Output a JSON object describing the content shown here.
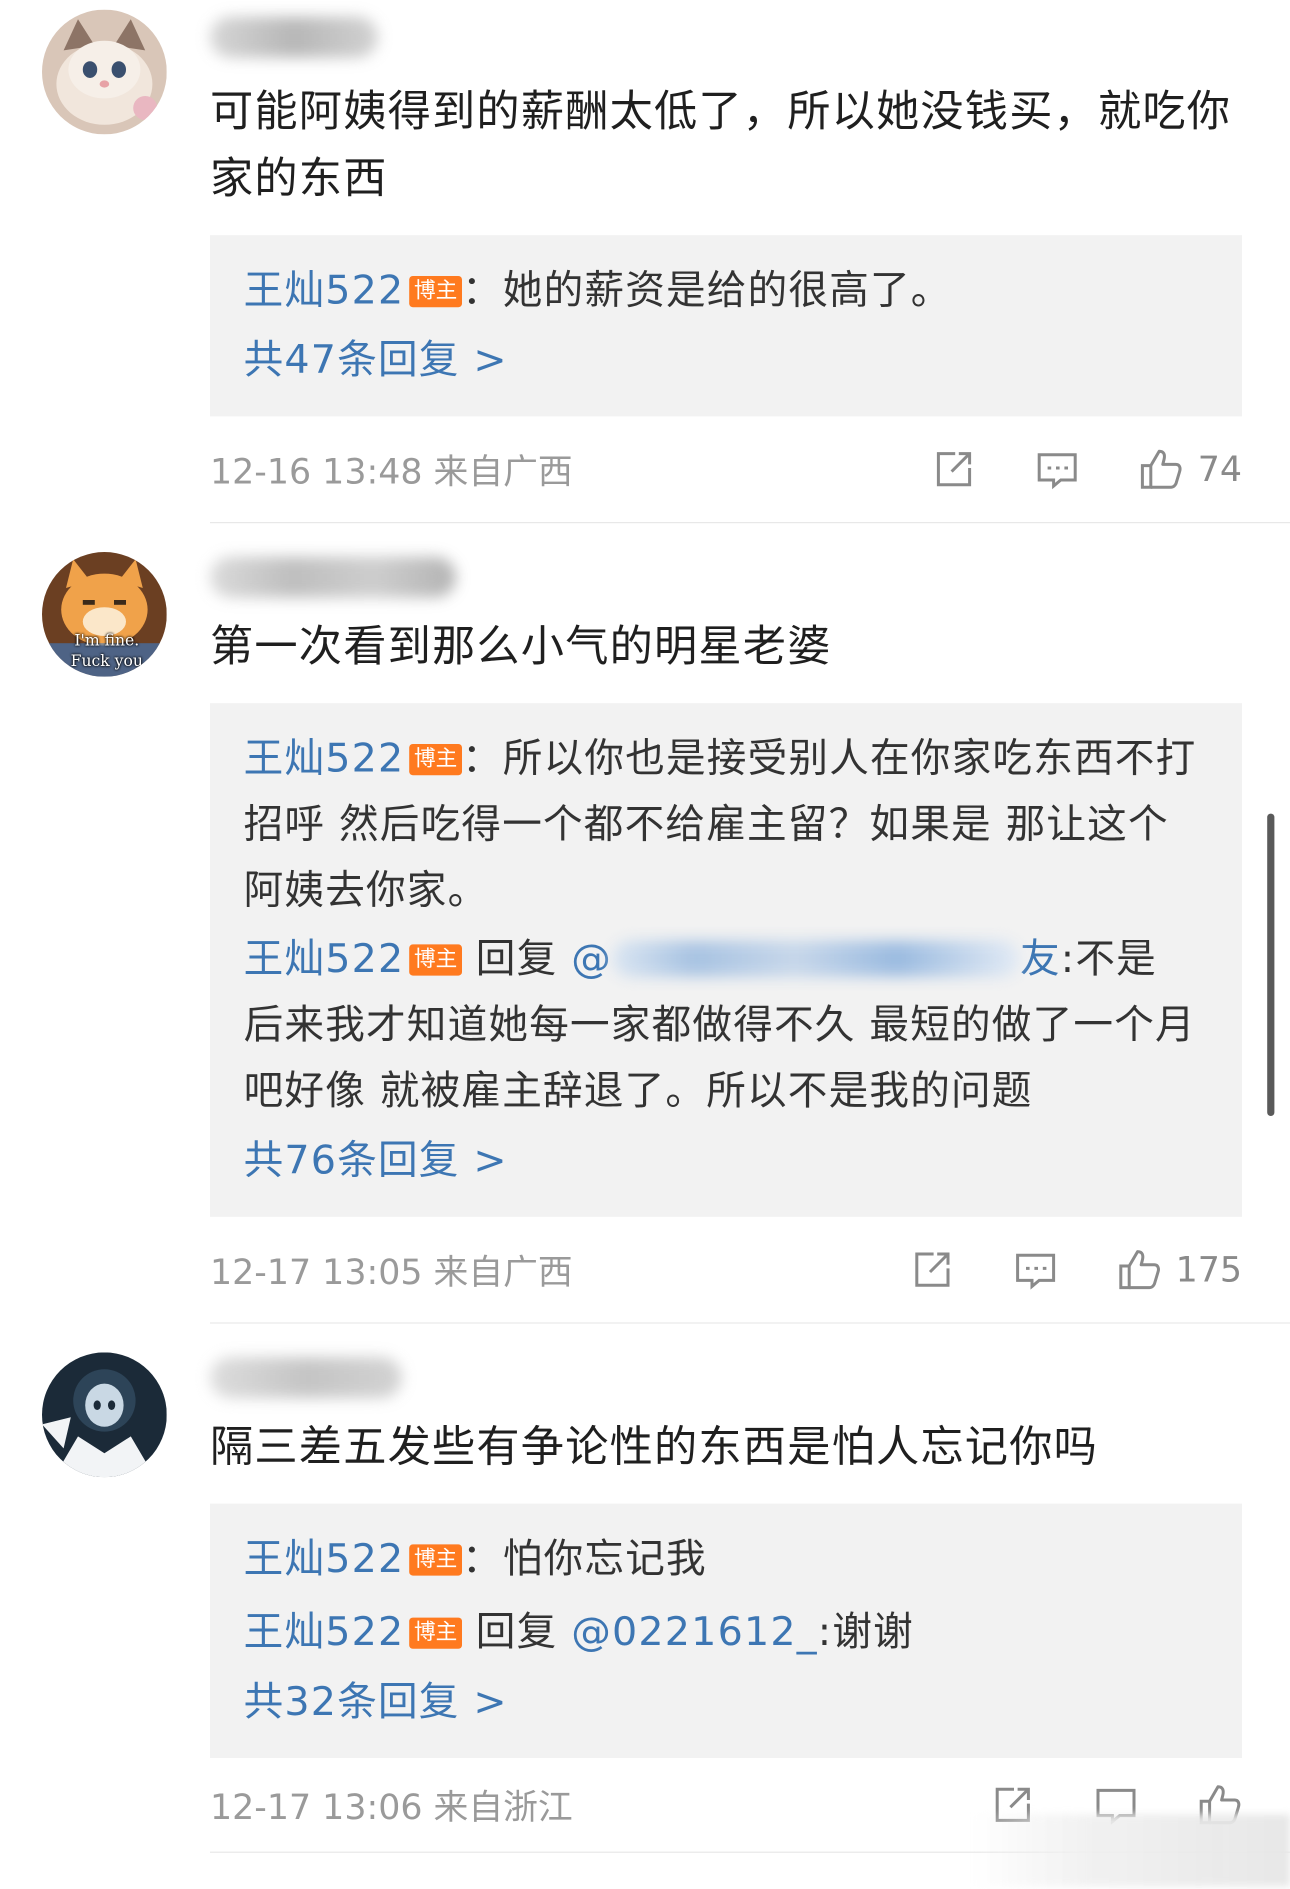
{
  "comments": [
    {
      "text": "可能阿姨得到的薪酬太低了，所以她没钱买，就吃你家的东西",
      "replies": [
        {
          "author": "王灿522",
          "badge": "博主",
          "sep": "：",
          "text": "她的薪资是给的很高了。"
        }
      ],
      "more": "共47条回复 >",
      "time": "12-16 13:48 来自广西",
      "likes": "74"
    },
    {
      "text": "第一次看到那么小气的明星老婆",
      "replies": [
        {
          "author": "王灿522",
          "badge": "博主",
          "sep": "：",
          "text": "所以你也是接受别人在你家吃东西不打招呼 然后吃得一个都不给雇主留？如果是 那让这个阿姨去你家。"
        },
        {
          "author": "王灿522",
          "badge": "博主",
          "reply_word": "回复",
          "mention_prefix": "@",
          "mention_suffix": "友",
          "text": ":不是 后来我才知道她每一家都做得不久 最短的做了一个月吧好像 就被雇主辞退了。所以不是我的问题"
        }
      ],
      "more": "共76条回复 >",
      "time": "12-17 13:05 来自广西",
      "likes": "175"
    },
    {
      "text": "隔三差五发些有争论性的东西是怕人忘记你吗",
      "replies": [
        {
          "author": "王灿522",
          "badge": "博主",
          "sep": "：",
          "text": "怕你忘记我"
        },
        {
          "author": "王灿522",
          "badge": "博主",
          "reply_word": "回复",
          "mention": "@0221612_",
          "text": ":谢谢"
        }
      ],
      "more": "共32条回复 >",
      "time": "12-17 13:06 来自浙江"
    }
  ],
  "avatar2_caption": "I'm fine. Fuck you",
  "icons": {
    "share": "share-icon",
    "comment": "comment-icon",
    "like": "thumbs-up-icon"
  },
  "colors": {
    "link_blue": "#3d76b3",
    "badge_orange": "#ff7a1f",
    "reply_bg": "#f2f2f2",
    "meta_gray": "#9a9a9a"
  }
}
